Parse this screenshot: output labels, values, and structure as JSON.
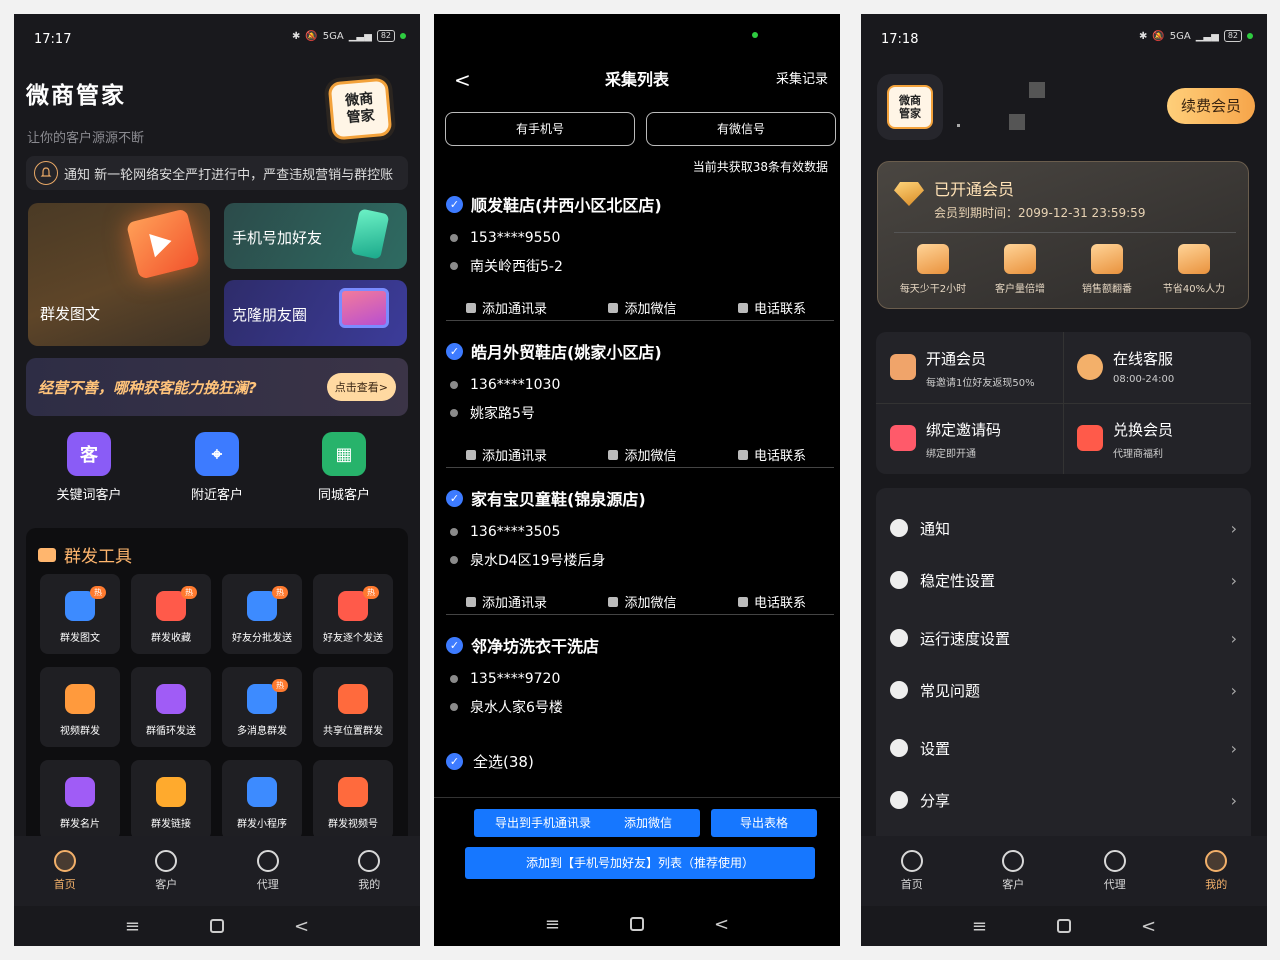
{
  "screen1": {
    "time": "17:17",
    "signal": "5GA",
    "battery": "82",
    "app_title": "微商管家",
    "app_subtitle": "让你的客户源源不断",
    "logo_text": "微商\n管家",
    "notice": "通知  新一轮网络安全严打进行中，严查违规营销与群控账",
    "cards": {
      "mass_post": "群发图文",
      "phone_add": "手机号加好友",
      "clone_moments": "克隆朋友圈"
    },
    "banner": {
      "text": "经营不善，哪种获客能力挽狂澜?",
      "button": "点击查看>"
    },
    "quick": [
      {
        "label": "关键词客户",
        "glyph": "客",
        "color": "#8a5cf6"
      },
      {
        "label": "附近客户",
        "glyph": "⌖",
        "color": "#3d7bff"
      },
      {
        "label": "同城客户",
        "glyph": "▦",
        "color": "#27b36b"
      }
    ],
    "tools_title": "群发工具",
    "tools": [
      {
        "label": "群发图文",
        "hot": "热",
        "color": "#3d8bff"
      },
      {
        "label": "群发收藏",
        "hot": "热",
        "color": "#ff5a4a"
      },
      {
        "label": "好友分批发送",
        "hot": "热",
        "color": "#3d8bff"
      },
      {
        "label": "好友逐个发送",
        "hot": "热",
        "color": "#ff5a4a"
      },
      {
        "label": "视频群发",
        "hot": "",
        "color": "#ff9a3d"
      },
      {
        "label": "群循环发送",
        "hot": "",
        "color": "#a05cf6"
      },
      {
        "label": "多消息群发",
        "hot": "热",
        "color": "#3d8bff"
      },
      {
        "label": "共享位置群发",
        "hot": "",
        "color": "#ff6a3d"
      },
      {
        "label": "群发名片",
        "hot": "",
        "color": "#a05cf6"
      },
      {
        "label": "群发链接",
        "hot": "",
        "color": "#ffaa2d"
      },
      {
        "label": "群发小程序",
        "hot": "",
        "color": "#3d8bff"
      },
      {
        "label": "群发视频号",
        "hot": "",
        "color": "#ff6a3d"
      }
    ],
    "tabs": [
      "首页",
      "客户",
      "代理",
      "我的"
    ]
  },
  "screen2": {
    "title": "采集列表",
    "record": "采集记录",
    "back": "<",
    "filters": [
      "有手机号",
      "有微信号"
    ],
    "count": "当前共获取38条有效数据",
    "items": [
      {
        "name": "顺发鞋店(井西小区北区店)",
        "phone": "153****9550",
        "addr": "南关岭西街5-2"
      },
      {
        "name": "皓月外贸鞋店(姚家小区店)",
        "phone": "136****1030",
        "addr": "姚家路5号"
      },
      {
        "name": "家有宝贝童鞋(锦泉源店)",
        "phone": "136****3505",
        "addr": "泉水D4区19号楼后身"
      },
      {
        "name": "邻净坊洗衣干洗店",
        "phone": "135****9720",
        "addr": "泉水人家6号楼"
      }
    ],
    "actions": [
      "添加通讯录",
      "添加微信",
      "电话联系"
    ],
    "select_all": "全选(38)",
    "buttons": [
      "导出到手机通讯录",
      "添加微信",
      "导出表格"
    ],
    "big_button": "添加到【手机号加好友】列表（推荐使用）"
  },
  "screen3": {
    "time": "17:18",
    "signal": "5GA",
    "battery": "82",
    "logo_text": "微商\n管家",
    "renew": "续费会员",
    "vip_title": "已开通会员",
    "vip_expiry": "会员到期时间：2099-12-31 23:59:59",
    "perks": [
      "每天少干2小时",
      "客户量倍增",
      "销售额翻番",
      "节省40%人力"
    ],
    "grid": [
      {
        "title": "开通会员",
        "sub": "每邀请1位好友返现50%",
        "color": "#f0a46a"
      },
      {
        "title": "在线客服",
        "sub": "08:00-24:00",
        "color": "#f3b06a"
      },
      {
        "title": "绑定邀请码",
        "sub": "绑定即开通",
        "color": "#ff5a6a"
      },
      {
        "title": "兑换会员",
        "sub": "代理商福利",
        "color": "#ff5a4a"
      }
    ],
    "menu": [
      "通知",
      "稳定性设置",
      "运行速度设置",
      "常见问题",
      "设置",
      "分享"
    ],
    "tabs": [
      "首页",
      "客户",
      "代理",
      "我的"
    ]
  }
}
